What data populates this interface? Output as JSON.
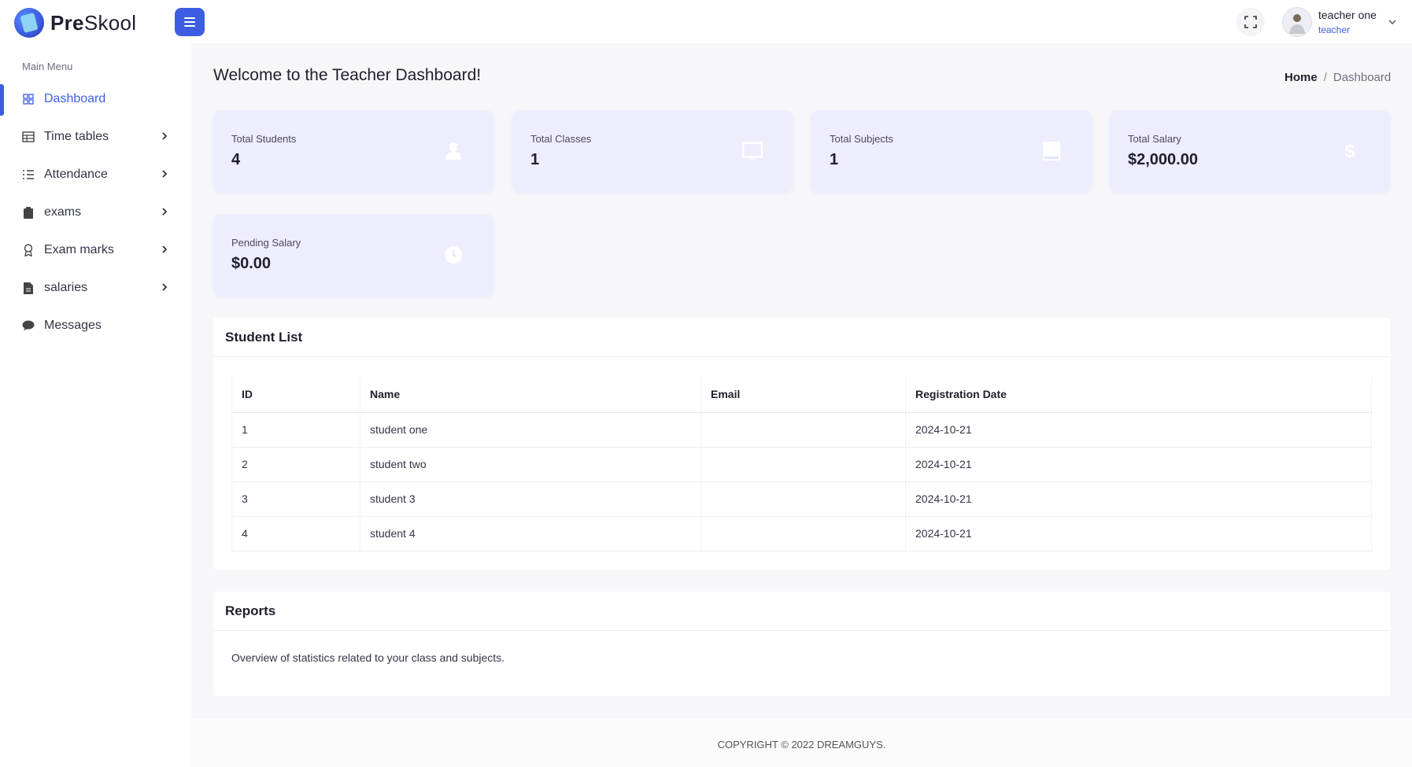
{
  "app": {
    "name_bold": "Pre",
    "name_rest": "Skool"
  },
  "header": {
    "user_name": "teacher one",
    "user_role": "teacher"
  },
  "sidebar": {
    "menu_title": "Main Menu",
    "items": [
      {
        "label": "Dashboard",
        "icon": "grid-icon",
        "active": true,
        "has_arrow": false
      },
      {
        "label": "Time tables",
        "icon": "table-icon",
        "active": false,
        "has_arrow": true
      },
      {
        "label": "Attendance",
        "icon": "list-check-icon",
        "active": false,
        "has_arrow": true
      },
      {
        "label": "exams",
        "icon": "clipboard-icon",
        "active": false,
        "has_arrow": true
      },
      {
        "label": "Exam marks",
        "icon": "award-icon",
        "active": false,
        "has_arrow": true
      },
      {
        "label": "salaries",
        "icon": "invoice-icon",
        "active": false,
        "has_arrow": true
      },
      {
        "label": "Messages",
        "icon": "chat-icon",
        "active": false,
        "has_arrow": false
      }
    ]
  },
  "main": {
    "title": "Welcome to the Teacher Dashboard!",
    "breadcrumb": {
      "home": "Home",
      "separator": "/",
      "current": "Dashboard"
    }
  },
  "stats": [
    {
      "label": "Total Students",
      "value": "4",
      "icon": "student-icon"
    },
    {
      "label": "Total Classes",
      "value": "1",
      "icon": "chalkboard-icon"
    },
    {
      "label": "Total Subjects",
      "value": "1",
      "icon": "book-icon"
    },
    {
      "label": "Total Salary",
      "value": "$2,000.00",
      "icon": "dollar-icon"
    },
    {
      "label": "Pending Salary",
      "value": "$0.00",
      "icon": "clock-icon"
    }
  ],
  "student_list": {
    "title": "Student List",
    "columns": [
      "ID",
      "Name",
      "Email",
      "Registration Date"
    ],
    "rows": [
      [
        "1",
        "student one",
        "",
        "2024-10-21"
      ],
      [
        "2",
        "student two",
        "",
        "2024-10-21"
      ],
      [
        "3",
        "student 3",
        "",
        "2024-10-21"
      ],
      [
        "4",
        "student 4",
        "",
        "2024-10-21"
      ]
    ]
  },
  "reports": {
    "title": "Reports",
    "text": "Overview of statistics related to your class and subjects."
  },
  "footer": {
    "copyright": "COPYRIGHT © 2022 DREAMGUYS."
  },
  "colors": {
    "accent": "#3d5ee1",
    "card_bg": "#eceefd",
    "page_bg": "#f7f7fa"
  }
}
